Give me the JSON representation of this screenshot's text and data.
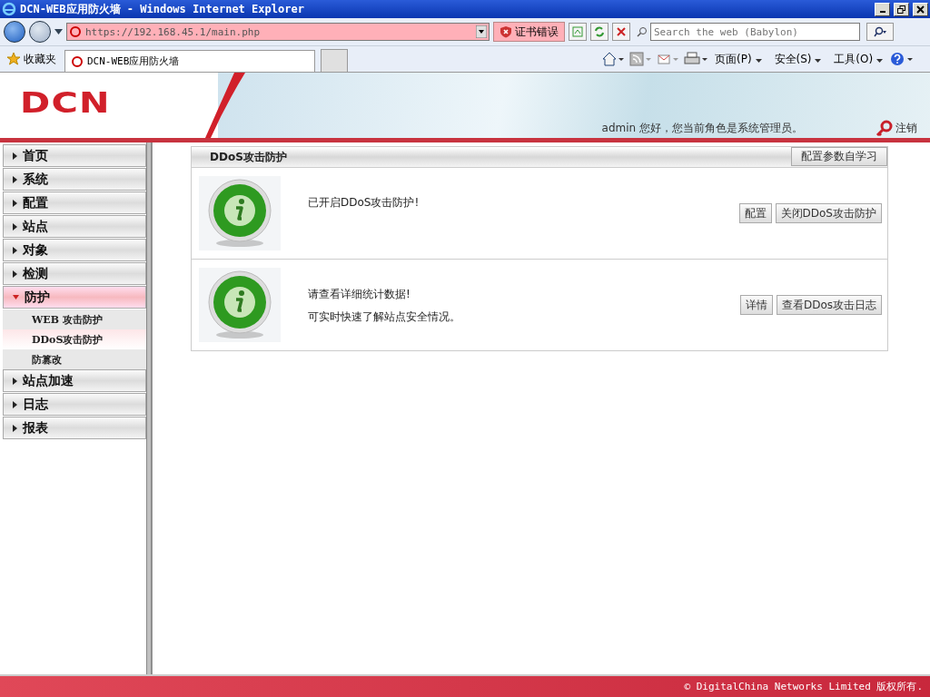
{
  "window": {
    "title": "DCN-WEB应用防火墙 - Windows Internet Explorer"
  },
  "address_bar": {
    "url": "https://192.168.45.1/main.php",
    "cert_error": "证书错误",
    "search_placeholder": "Search the web (Babylon)"
  },
  "favorites": {
    "label": "收藏夹"
  },
  "tabs": [
    {
      "label": "DCN-WEB应用防火墙",
      "selected": true
    }
  ],
  "command_bar": [
    "页面(P)",
    "安全(S)",
    "工具(O)"
  ],
  "header": {
    "logo": "DCN",
    "greeting": "admin 您好，您当前角色是系统管理员。",
    "logout": "注销"
  },
  "sidebar": {
    "items": [
      {
        "label": "首页",
        "expanded": false
      },
      {
        "label": "系统",
        "expanded": false
      },
      {
        "label": "配置",
        "expanded": false
      },
      {
        "label": "站点",
        "expanded": false
      },
      {
        "label": "对象",
        "expanded": false
      },
      {
        "label": "检测",
        "expanded": false
      },
      {
        "label": "防护",
        "expanded": true,
        "children": [
          {
            "label": "WEB 攻击防护",
            "selected": false
          },
          {
            "label": "DDoS攻击防护",
            "selected": true
          },
          {
            "label": "防篡改",
            "selected": false
          }
        ]
      },
      {
        "label": "站点加速",
        "expanded": false
      },
      {
        "label": "日志",
        "expanded": false
      },
      {
        "label": "报表",
        "expanded": false
      }
    ]
  },
  "panel": {
    "title": "DDoS攻击防护",
    "action": "配置参数自学习",
    "rows": [
      {
        "lines": [
          "已开启DDoS攻击防护!"
        ],
        "buttons": [
          "配置",
          "关闭DDoS攻击防护"
        ]
      },
      {
        "lines": [
          "请查看详细统计数据!",
          "可实时快速了解站点安全情况。"
        ],
        "buttons": [
          "详情",
          "查看DDos攻击日志"
        ]
      }
    ]
  },
  "footer": {
    "copyright": "© DigitalChina Networks Limited 版权所有."
  }
}
